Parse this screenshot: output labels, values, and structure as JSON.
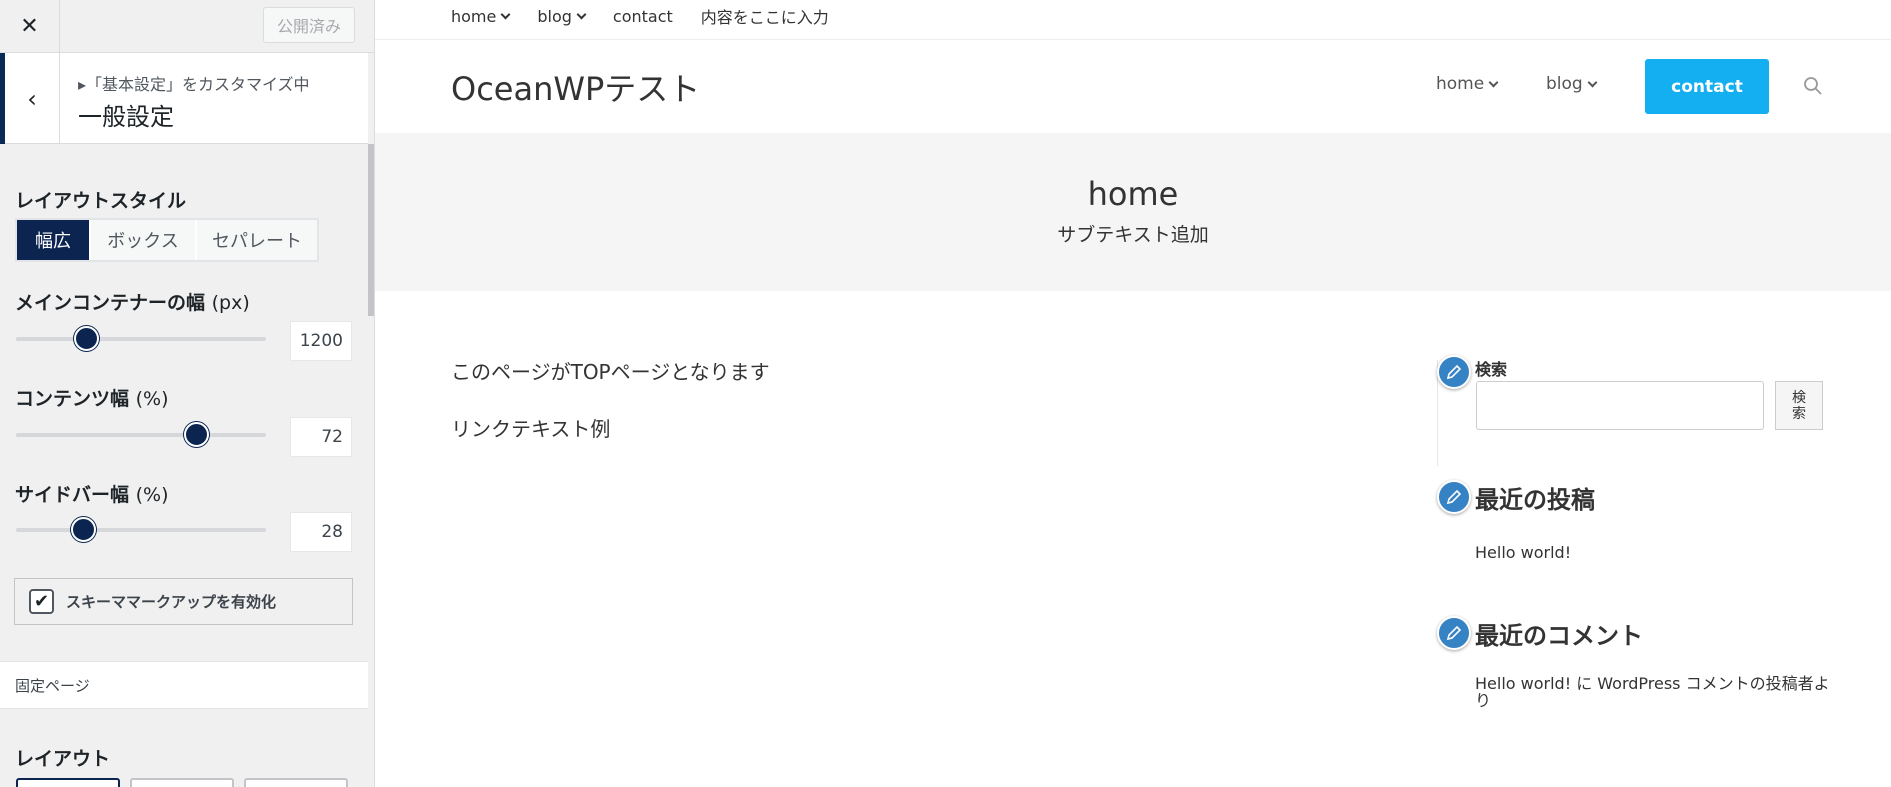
{
  "customizer": {
    "close_icon": "close-icon",
    "publish_label": "公開済み",
    "breadcrumb": "▸「基本設定」をカスタマイズ中",
    "section_title": "一般設定",
    "layout_style": {
      "label": "レイアウトスタイル",
      "options": [
        "幅広",
        "ボックス",
        "セパレート"
      ],
      "selected": "幅広"
    },
    "main_container": {
      "label": "メインコンテナーの幅",
      "unit": "(px)",
      "value": "1200",
      "fraction": 0.28
    },
    "content_width": {
      "label": "コンテンツ幅",
      "unit": "(%)",
      "value": "72",
      "fraction": 0.72
    },
    "sidebar_width": {
      "label": "サイドバー幅",
      "unit": "(%)",
      "value": "28",
      "fraction": 0.27
    },
    "schema": {
      "label": "スキーママークアップを有効化",
      "checked": true
    },
    "static_page_label": "固定ページ",
    "layout_label": "レイアウト",
    "accent_color": "#0b2450"
  },
  "preview": {
    "topbar_nav": [
      "home",
      "blog",
      "contact",
      "内容をここに入力"
    ],
    "site_title": "OceanWPテスト",
    "main_nav": {
      "home": "home",
      "blog": "blog",
      "contact": "contact"
    },
    "contact_color": "#13aff0",
    "page_title": "home",
    "page_subtitle": "サブテキスト追加",
    "content_text": "このページがTOPページとなります",
    "content_link": "リンクテキスト例",
    "widgets": {
      "search_label": "検索",
      "search_button": "検索",
      "recent_posts_title": "最近の投稿",
      "recent_post": "Hello world!",
      "recent_comments_title": "最近のコメント",
      "recent_comment": "Hello world! に WordPress コメントの投稿者より"
    },
    "edit_icon_color": "#3582c4"
  }
}
